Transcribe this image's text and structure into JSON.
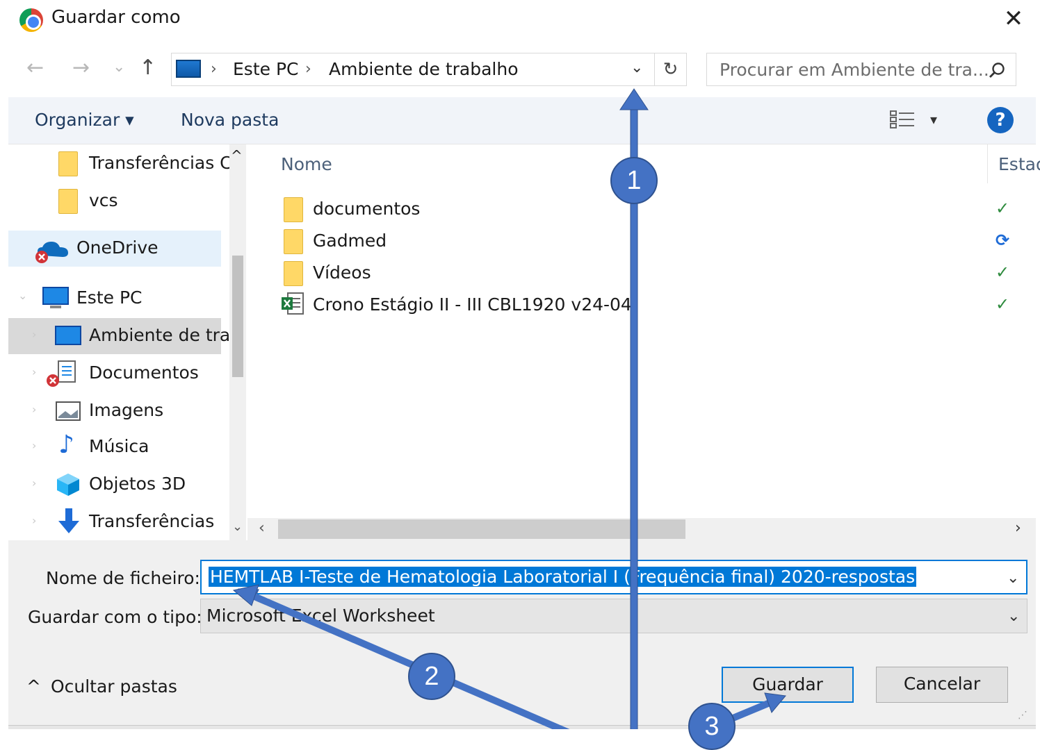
{
  "window": {
    "title": "Guardar como",
    "close_label": "✕"
  },
  "nav": {
    "back": "←",
    "forward": "→",
    "recent": "⌄",
    "up": "↑"
  },
  "address": {
    "crumbs": [
      "Este PC",
      "Ambiente de trabalho"
    ],
    "separator": "›",
    "dropdown": "⌄",
    "refresh": "↻"
  },
  "search": {
    "placeholder": "Procurar em Ambiente de tra...",
    "icon": "search-icon"
  },
  "toolbar": {
    "organize_label": "Organizar ▾",
    "new_folder_label": "Nova pasta",
    "view_icon": "⋮☷",
    "view_dd": "▾",
    "help_label": "?"
  },
  "sidebar": {
    "items": [
      {
        "label": "Transferências C",
        "icon": "folder-icon"
      },
      {
        "label": "vcs",
        "icon": "folder-icon"
      },
      {
        "label": "OneDrive",
        "icon": "cloud-icon"
      },
      {
        "label": "Este PC",
        "icon": "computer-icon"
      },
      {
        "label": "Ambiente de tra",
        "icon": "desktop-icon"
      },
      {
        "label": "Documentos",
        "icon": "documents-icon"
      },
      {
        "label": "Imagens",
        "icon": "pictures-icon"
      },
      {
        "label": "Música",
        "icon": "music-icon"
      },
      {
        "label": "Objetos 3D",
        "icon": "3d-objects-icon"
      },
      {
        "label": "Transferências",
        "icon": "downloads-icon"
      }
    ],
    "scroll_up": "^",
    "scroll_down": "⌄"
  },
  "files": {
    "columns": {
      "name": "Nome",
      "status": "Estad"
    },
    "rows": [
      {
        "name": "documentos",
        "type": "folder",
        "status": "✓"
      },
      {
        "name": "Gadmed",
        "type": "folder",
        "status": "⟳"
      },
      {
        "name": "Vídeos",
        "type": "folder",
        "status": "✓"
      },
      {
        "name": "Crono Estágio II - III CBL1920 v24-04",
        "type": "excel",
        "status": "✓"
      }
    ],
    "hscroll_left": "‹",
    "hscroll_right": "›"
  },
  "form": {
    "filename_label": "Nome de ficheiro:",
    "filename_value": "HEMTLAB I-Teste de Hematologia Laboratorial I (Frequência final) 2020-respostas",
    "filetype_label": "Guardar com o tipo:",
    "filetype_value": "Microsoft Excel Worksheet",
    "dropdown": "⌄",
    "hide_folders_label": "Ocultar pastas",
    "hide_folders_icon": "^",
    "save_label": "Guardar",
    "cancel_label": "Cancelar"
  },
  "annotations": {
    "step1": "1",
    "step2": "2",
    "step3": "3",
    "color": "#4472c4"
  }
}
